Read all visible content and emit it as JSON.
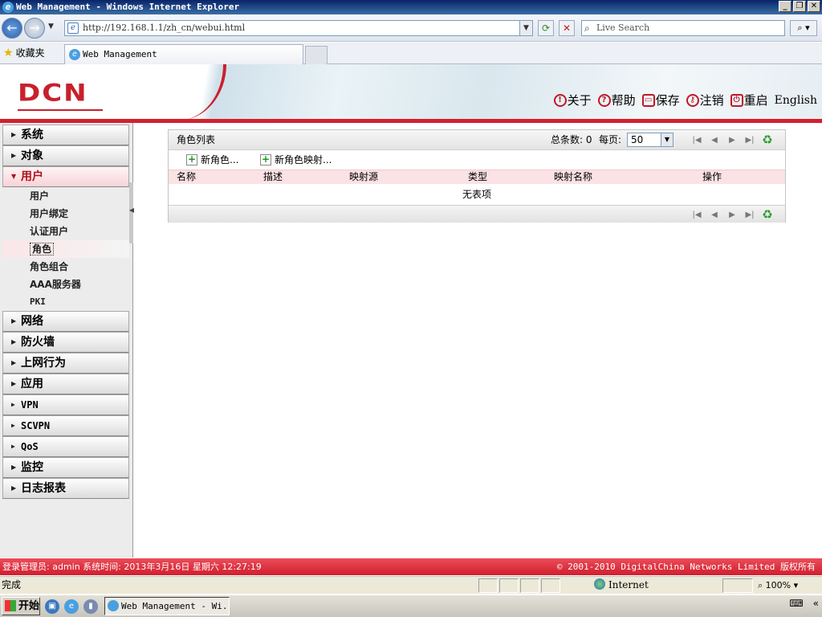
{
  "window": {
    "title": "Web Management - Windows Internet Explorer",
    "minimize": "_",
    "restore": "❐",
    "close": "✕"
  },
  "browser": {
    "back": "←",
    "forward": "→",
    "url": "http://192.168.1.1/zh_cn/webui.html",
    "search_placeholder": "Live Search",
    "favorites": "收藏夹",
    "tab_title": "Web Management",
    "status_done": "完成",
    "zone": "Internet",
    "zoom": "100%"
  },
  "header": {
    "logo": "DCN",
    "links": {
      "about": "关于",
      "help": "帮助",
      "save": "保存",
      "logout": "注销",
      "reboot": "重启",
      "english": "English"
    }
  },
  "sidebar": {
    "sections_top": [
      {
        "label": "系统"
      },
      {
        "label": "对象"
      }
    ],
    "open_section": {
      "label": "用户"
    },
    "subitems": [
      {
        "label": "用户"
      },
      {
        "label": "用户绑定"
      },
      {
        "label": "认证用户"
      },
      {
        "label": "角色"
      },
      {
        "label": "角色组合"
      },
      {
        "label": "AAA服务器"
      },
      {
        "label": "PKI"
      }
    ],
    "sections_bottom": [
      {
        "label": "网络"
      },
      {
        "label": "防火墙"
      },
      {
        "label": "上网行为"
      },
      {
        "label": "应用"
      },
      {
        "label": "VPN"
      },
      {
        "label": "SCVPN"
      },
      {
        "label": "QoS"
      },
      {
        "label": "监控"
      },
      {
        "label": "日志报表"
      }
    ]
  },
  "grid": {
    "title": "角色列表",
    "total_label": "总条数: 0",
    "per_page_label": "每页:",
    "per_page_value": "50",
    "toolbar": {
      "new_role": "新角色...",
      "new_role_mapping": "新角色映射..."
    },
    "columns": [
      "名称",
      "描述",
      "映射源",
      "类型",
      "映射名称",
      "操作"
    ],
    "empty_text": "无表项"
  },
  "status": {
    "left": "登录管理员: admin 系统时间: 2013年3月16日 星期六 12:27:19",
    "right": "© 2001-2010 DigitalChina Networks Limited 版权所有"
  },
  "taskbar": {
    "start": "开始",
    "task_item": "Web Management - Wi..."
  }
}
